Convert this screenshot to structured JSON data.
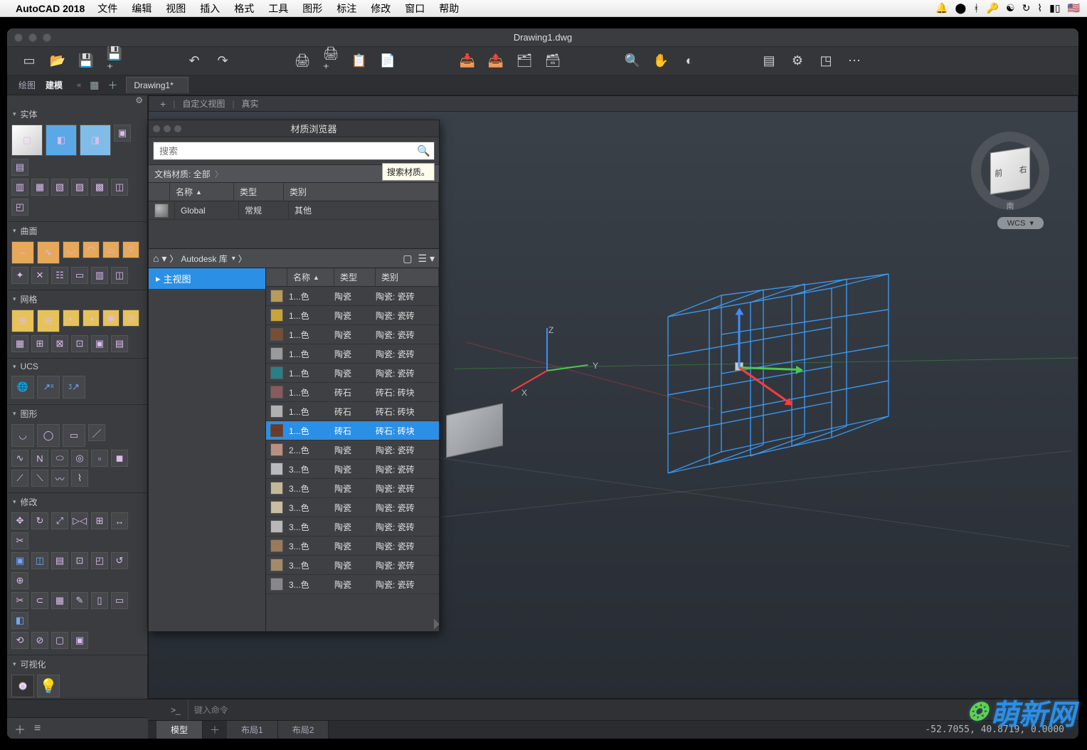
{
  "mac": {
    "app_name": "AutoCAD 2018",
    "menus": [
      "文件",
      "编辑",
      "视图",
      "插入",
      "格式",
      "工具",
      "图形",
      "标注",
      "修改",
      "窗口",
      "帮助"
    ]
  },
  "window": {
    "title": "Drawing1.dwg"
  },
  "tabs": {
    "draw": "绘图",
    "model": "建模",
    "drawing_tab": "Drawing1*"
  },
  "canvas_crumbs": {
    "custom_view": "自定义视图",
    "realistic": "真实"
  },
  "palettes": {
    "entity": "实体",
    "surface": "曲面",
    "mesh": "网格",
    "ucs": "UCS",
    "geometry": "图形",
    "modify": "修改",
    "visualize": "可视化"
  },
  "material_browser": {
    "title": "材质浏览器",
    "search_placeholder": "搜索",
    "search_tooltip": "搜索材质。",
    "doc_materials_label": "文档材质: 全部",
    "cols": {
      "name": "名称",
      "type": "类型",
      "category": "类别"
    },
    "doc_rows": [
      {
        "name": "Global",
        "type": "常规",
        "category": "其他"
      }
    ],
    "library_label": "Autodesk 库",
    "tree_main_view": "主视图",
    "lib_rows": [
      {
        "sw": "#b89a5a",
        "name": "1...色",
        "type": "陶瓷",
        "cat": "陶瓷: 瓷砖"
      },
      {
        "sw": "#c9a23a",
        "name": "1...色",
        "type": "陶瓷",
        "cat": "陶瓷: 瓷砖"
      },
      {
        "sw": "#7a4e30",
        "name": "1...色",
        "type": "陶瓷",
        "cat": "陶瓷: 瓷砖"
      },
      {
        "sw": "#9a9a9a",
        "name": "1...色",
        "type": "陶瓷",
        "cat": "陶瓷: 瓷砖"
      },
      {
        "sw": "#2a7f86",
        "name": "1...色",
        "type": "陶瓷",
        "cat": "陶瓷: 瓷砖"
      },
      {
        "sw": "#8a5a5a",
        "name": "1...色",
        "type": "砖石",
        "cat": "砖石: 砖块"
      },
      {
        "sw": "#b0b0b0",
        "name": "1...色",
        "type": "砖石",
        "cat": "砖石: 砖块"
      },
      {
        "sw": "#6e3a2a",
        "name": "1...色",
        "type": "砖石",
        "cat": "砖石: 砖块",
        "selected": true
      },
      {
        "sw": "#b89080",
        "name": "2...色",
        "type": "陶瓷",
        "cat": "陶瓷: 瓷砖"
      },
      {
        "sw": "#bababa",
        "name": "3...色",
        "type": "陶瓷",
        "cat": "陶瓷: 瓷砖"
      },
      {
        "sw": "#c4b89a",
        "name": "3...色",
        "type": "陶瓷",
        "cat": "陶瓷: 瓷砖"
      },
      {
        "sw": "#c9bda0",
        "name": "3...色",
        "type": "陶瓷",
        "cat": "陶瓷: 瓷砖"
      },
      {
        "sw": "#b8b8b8",
        "name": "3...色",
        "type": "陶瓷",
        "cat": "陶瓷: 瓷砖"
      },
      {
        "sw": "#9a7a5a",
        "name": "3...色",
        "type": "陶瓷",
        "cat": "陶瓷: 瓷砖"
      },
      {
        "sw": "#a28a6a",
        "name": "3...色",
        "type": "陶瓷",
        "cat": "陶瓷: 瓷砖"
      },
      {
        "sw": "#888888",
        "name": "3...色",
        "type": "陶瓷",
        "cat": "陶瓷: 瓷砖"
      }
    ]
  },
  "viewcube": {
    "front": "前",
    "right": "右",
    "wcs": "WCS"
  },
  "cmd": {
    "prompt": ">_",
    "placeholder": "键入命令"
  },
  "layout_tabs": {
    "model": "模型",
    "layout1": "布局1",
    "layout2": "布局2"
  },
  "coords": "-52.7055, 40.8719, 0.0000",
  "watermark": "萌新网"
}
